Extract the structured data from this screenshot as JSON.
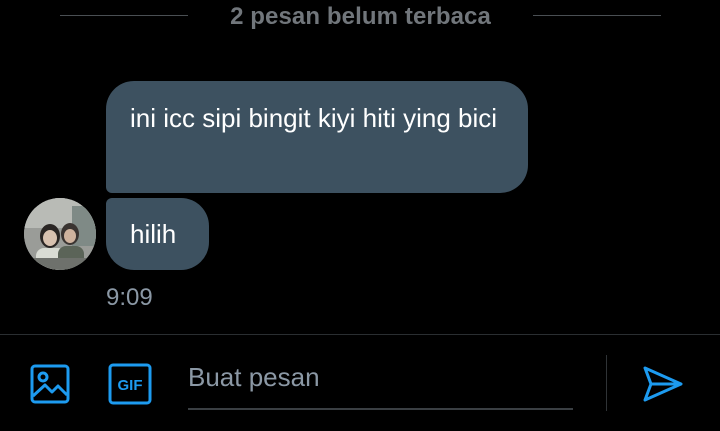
{
  "conversation": {
    "unread_label": "2 pesan belum terbaca",
    "messages": [
      {
        "text": "ini icc sipi bingit kiyi hiti ying bici"
      },
      {
        "text": "hilih"
      }
    ],
    "timestamp": "9:09"
  },
  "composer": {
    "placeholder": "Buat pesan",
    "gif_label": "GIF",
    "media_icon": "image-icon",
    "send_icon": "send-icon"
  },
  "colors": {
    "accent": "#1d9bf0",
    "bubble": "#3d5160",
    "background": "#000000",
    "muted_text": "#71767b"
  }
}
